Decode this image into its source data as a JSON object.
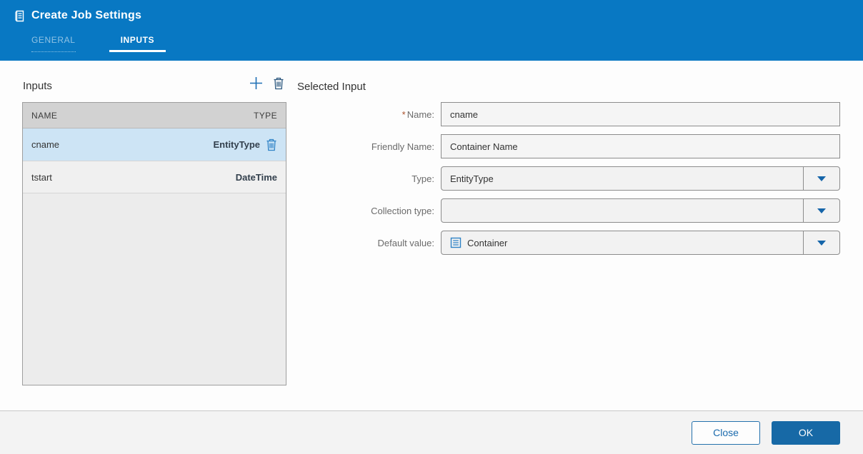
{
  "header": {
    "title": "Create Job Settings",
    "tabs": [
      {
        "label": "GENERAL",
        "active": false
      },
      {
        "label": "INPUTS",
        "active": true
      }
    ]
  },
  "inputs_panel": {
    "title": "Inputs",
    "columns": {
      "name": "NAME",
      "type": "TYPE"
    },
    "rows": [
      {
        "name": "cname",
        "type": "EntityType",
        "selected": true
      },
      {
        "name": "tstart",
        "type": "DateTime",
        "selected": false
      }
    ],
    "icons": [
      "plus-icon",
      "trash-icon"
    ]
  },
  "selected_input": {
    "title": "Selected Input",
    "required_marker": "*",
    "fields": {
      "name": {
        "label": "Name:",
        "required": true,
        "value": "cname"
      },
      "friendly_name": {
        "label": "Friendly Name:",
        "value": "Container Name"
      },
      "type": {
        "label": "Type:",
        "value": "EntityType"
      },
      "collection_type": {
        "label": "Collection type:",
        "value": ""
      },
      "default_value": {
        "label": "Default value:",
        "value": "Container",
        "icon": "list-icon"
      }
    }
  },
  "footer": {
    "close_label": "Close",
    "ok_label": "OK"
  },
  "colors": {
    "header_blue": "#0878c3",
    "accent_blue": "#1a6aad",
    "ok_button_blue": "#1769a6",
    "selected_row_blue": "#cde4f5",
    "required_marker": "#a9502a"
  }
}
